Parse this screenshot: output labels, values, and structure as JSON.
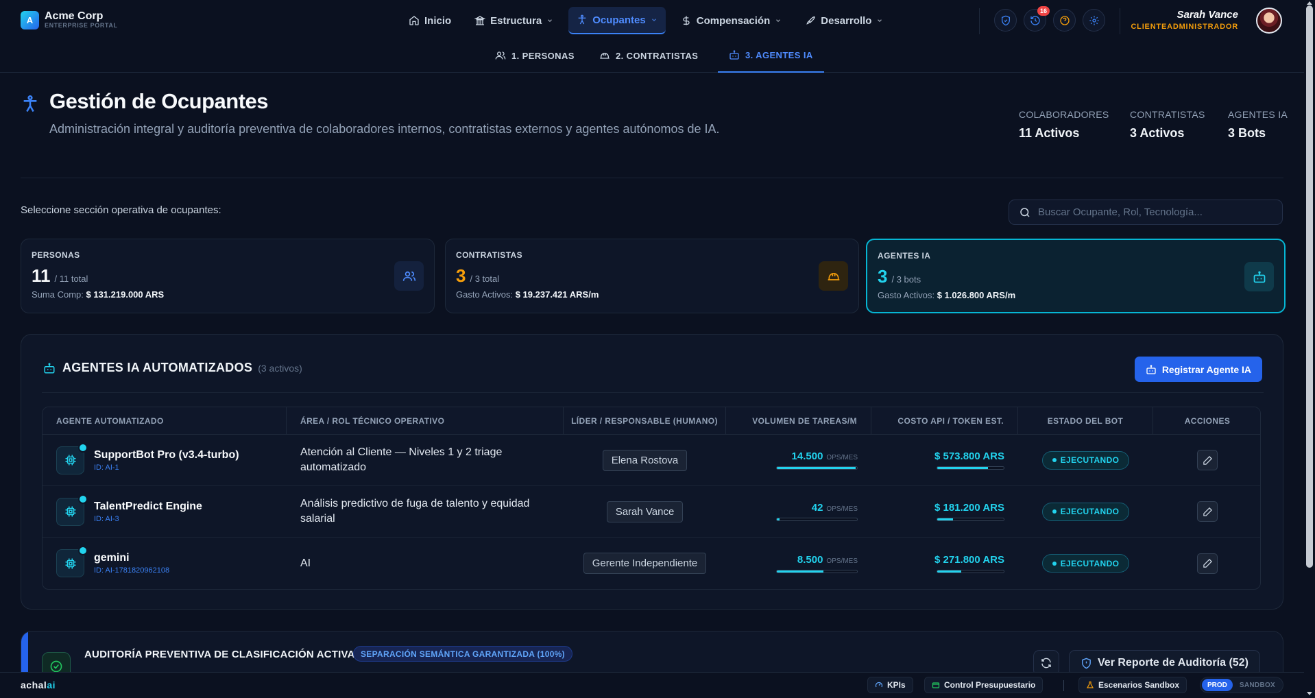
{
  "brand": {
    "logo_letter": "A",
    "name": "Acme Corp",
    "subtitle": "ENTERPRISE PORTAL"
  },
  "nav": {
    "items": [
      {
        "label": "Inicio",
        "icon": "home-icon"
      },
      {
        "label": "Estructura",
        "icon": "building-icon"
      },
      {
        "label": "Ocupantes",
        "icon": "person-icon",
        "active": true
      },
      {
        "label": "Compensación",
        "icon": "dollar-icon"
      },
      {
        "label": "Desarrollo",
        "icon": "rocket-icon"
      }
    ]
  },
  "header_actions": {
    "notifications_count": "16"
  },
  "user": {
    "name": "Sarah Vance",
    "role": "CLIENTEADMINISTRADOR"
  },
  "subnav": {
    "items": [
      {
        "label": "1. PERSONAS"
      },
      {
        "label": "2. CONTRATISTAS"
      },
      {
        "label": "3. AGENTES IA",
        "active": true
      }
    ]
  },
  "page": {
    "title": "Gestión de Ocupantes",
    "subtitle": "Administración integral y auditoría preventiva de colaboradores internos, contratistas externos y agentes autónomos de IA."
  },
  "stats": [
    {
      "label": "COLABORADORES",
      "value": "11 Activos"
    },
    {
      "label": "CONTRATISTAS",
      "value": "3 Activos"
    },
    {
      "label": "AGENTES IA",
      "value": "3 Bots"
    }
  ],
  "section_label": "Seleccione sección operativa de ocupantes:",
  "search": {
    "placeholder": "Buscar Ocupante, Rol, Tecnología..."
  },
  "cards": [
    {
      "label": "PERSONAS",
      "count": "11",
      "total": "/ 11 total",
      "foot_label": "Suma Comp:",
      "foot_value": "$ 131.219.000 ARS",
      "color": "#f8fafc"
    },
    {
      "label": "CONTRATISTAS",
      "count": "3",
      "total": "/ 3 total",
      "foot_label": "Gasto Activos:",
      "foot_value": "$ 19.237.421 ARS/m",
      "color": "#f59e0b"
    },
    {
      "label": "AGENTES IA",
      "count": "3",
      "total": "/ 3 bots",
      "foot_label": "Gasto Activos:",
      "foot_value": "$ 1.026.800 ARS/m",
      "color": "#22d3ee"
    }
  ],
  "panel": {
    "title": "AGENTES IA AUTOMATIZADOS",
    "count": "(3 activos)",
    "register_label": "Registrar Agente IA",
    "columns": [
      "AGENTE AUTOMATIZADO",
      "ÁREA / ROL TÉCNICO OPERATIVO",
      "LÍDER / RESPONSABLE (HUMANO)",
      "VOLUMEN DE TAREAS/M",
      "COSTO API / TOKEN EST.",
      "ESTADO DEL BOT",
      "ACCIONES"
    ],
    "rows": [
      {
        "name": "SupportBot Pro (v3.4-turbo)",
        "id": "ID: AI-1",
        "area": "Atención al Cliente — Niveles 1 y 2 triage automatizado",
        "leader": "Elena Rostova",
        "ops": "14.500",
        "ops_unit": "OPS/MES",
        "ops_fraction": 0.98,
        "cost": "$ 573.800 ARS",
        "cost_fraction": 0.76,
        "status": "EJECUTANDO"
      },
      {
        "name": "TalentPredict Engine",
        "id": "ID: AI-3",
        "area": "Análisis predictivo de fuga de talento y equidad salarial",
        "leader": "Sarah Vance",
        "ops": "42",
        "ops_unit": "OPS/MES",
        "ops_fraction": 0.03,
        "cost": "$ 181.200 ARS",
        "cost_fraction": 0.24,
        "status": "EJECUTANDO"
      },
      {
        "name": "gemini",
        "id": "ID: AI-1781820962108",
        "area": "AI",
        "leader": "Gerente Independiente",
        "ops": "8.500",
        "ops_unit": "OPS/MES",
        "ops_fraction": 0.58,
        "cost": "$ 271.800 ARS",
        "cost_fraction": 0.36,
        "status": "EJECUTANDO"
      }
    ]
  },
  "audit": {
    "title": "AUDITORÍA PREVENTIVA DE CLASIFICACIÓN ACTIVA",
    "tag": "SEPARACIÓN SEMÁNTICA GARANTIZADA (100%)",
    "report_label": "Ver Reporte de Auditoría (52)"
  },
  "footer": {
    "brand_main": "achal",
    "brand_accent": "ai",
    "kpis": "KPIs",
    "budget": "Control Presupuestario",
    "sandbox": "Escenarios Sandbox",
    "env_prod": "PROD",
    "env_sandbox": "SANDBOX"
  },
  "colors": {
    "accent": "#3b82f6",
    "cyan": "#22d3ee",
    "amber": "#f59e0b",
    "background": "#0b1120"
  }
}
